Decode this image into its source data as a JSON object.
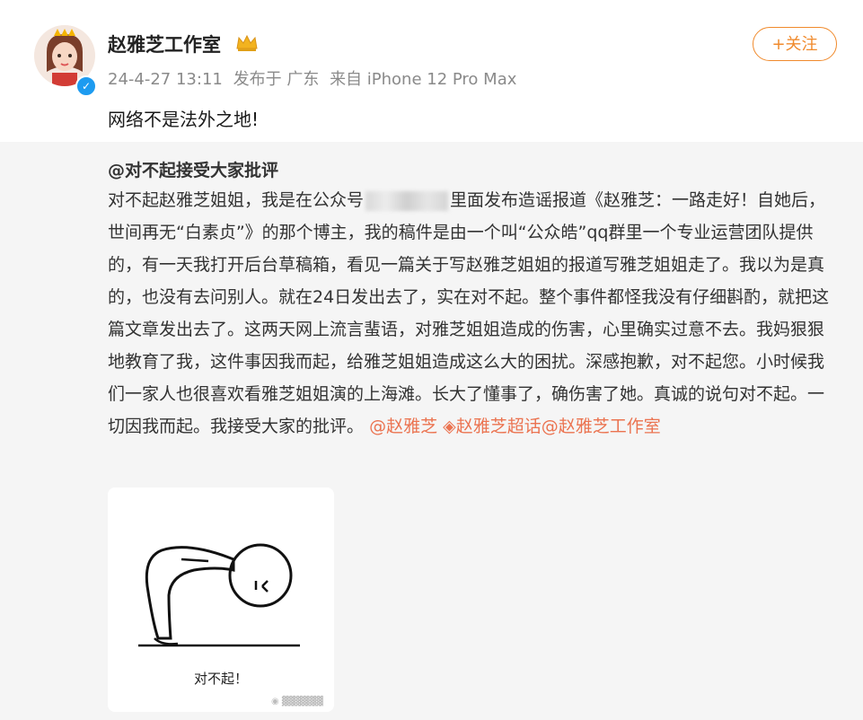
{
  "user": {
    "name": "赵雅芝工作室",
    "time": "24-4-27 13:11",
    "location": "发布于 广东",
    "source": "来自 iPhone 12 Pro Max",
    "follow_label": "+关注"
  },
  "post": {
    "text": "网络不是法外之地!"
  },
  "quote": {
    "author": "@对不起接受大家批评",
    "body_1": "对不起赵雅芝姐姐，我是在公众号",
    "body_2": "里面发布造谣报道《赵雅芝：一路走好！自她后，世间再无“白素贞”》的那个博主，我的稿件是由一个叫“公众皓”qq群里一个专业运营团队提供的，有一天我打开后台草稿箱，看见一篇关于写赵雅芝姐姐的报道写雅芝姐姐走了。我以为是真的，也没有去问别人。就在24日发出去了，实在对不起。整个事件都怪我没有仔细斟酌，就把这篇文章发出去了。这两天网上流言蜚语，对雅芝姐姐造成的伤害，心里确实过意不去。我妈狠狠地教育了我，这件事因我而起，给雅芝姐姐造成这么大的困扰。深感抱歉，对不起您。小时候我们一家人也很喜欢看雅芝姐姐演的上海滩。长大了懂事了，确伤害了她。真诚的说句对不起。一切因我而起。我接受大家的批评。",
    "mention_1": "@赵雅芝",
    "mention_2": "赵雅芝超话",
    "mention_3": "@赵雅芝工作室"
  },
  "image": {
    "caption": "对不起！"
  },
  "colors": {
    "accent": "#f08a2c",
    "mention": "#eb7350",
    "verified": "#1d9bf0"
  }
}
